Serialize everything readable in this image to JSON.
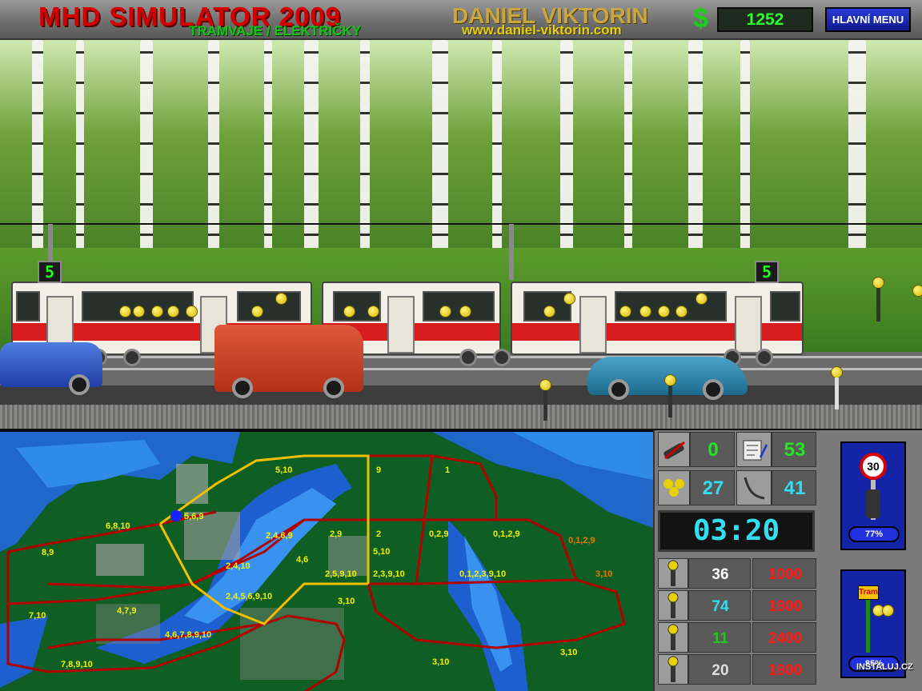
{
  "header": {
    "title": "MHD SIMULATOR 2009",
    "subtitle": "TRAMVAJE / ELEKTRIČKY",
    "author": "DANIEL VIKTORIN",
    "url": "www.daniel-viktorin.com",
    "money_symbol": "$",
    "money": "1252",
    "main_menu_label": "HLAVNÍ MENU"
  },
  "scene": {
    "tram_route_front": "5",
    "tram_route_rear": "5"
  },
  "map": {
    "labels": [
      {
        "text": "5,10"
      },
      {
        "text": "9"
      },
      {
        "text": "1"
      },
      {
        "text": "5,6,9"
      },
      {
        "text": "6,8,10"
      },
      {
        "text": "8,9"
      },
      {
        "text": "2,4,6,9"
      },
      {
        "text": "2,9"
      },
      {
        "text": "2"
      },
      {
        "text": "0,2,9"
      },
      {
        "text": "0,1,2,9"
      },
      {
        "text": "0,1,2,9"
      },
      {
        "text": "5,10"
      },
      {
        "text": "4,6"
      },
      {
        "text": "2,4,10"
      },
      {
        "text": "2,5,9,10"
      },
      {
        "text": "2,3,9,10"
      },
      {
        "text": "0,1,2,3,9,10"
      },
      {
        "text": "3,10"
      },
      {
        "text": "2,4,5,6,9,10"
      },
      {
        "text": "3,10"
      },
      {
        "text": "7,10"
      },
      {
        "text": "4,7,9"
      },
      {
        "text": "4,6,7,8,9,10"
      },
      {
        "text": "7,8,9,10"
      },
      {
        "text": "3,10"
      },
      {
        "text": "3,10"
      }
    ]
  },
  "panel": {
    "stats": [
      {
        "icon": "cancelled-tickets-icon",
        "value": "0",
        "color": "#22e622"
      },
      {
        "icon": "schedule-icon",
        "value": "53",
        "color": "#22e622"
      },
      {
        "icon": "waiting-passengers-icon",
        "value": "27",
        "color": "#34ddf0"
      },
      {
        "icon": "pantograph-icon",
        "value": "41",
        "color": "#34ddf0"
      }
    ],
    "clock": "03:20",
    "tram_types": [
      {
        "count": "36",
        "price": "1000",
        "count_color": "#ffffff"
      },
      {
        "count": "74",
        "price": "1800",
        "count_color": "#34ddf0"
      },
      {
        "count": "11",
        "price": "2400",
        "count_color": "#22c622"
      },
      {
        "count": "20",
        "price": "1800",
        "count_color": "#e0e0e0"
      }
    ],
    "price_color": "#ff1a1a",
    "speed_sign": "30",
    "speed_percent": "77%",
    "tram_stop_sign": "Tram",
    "stop_percent": "85%"
  },
  "watermark": "INSTALUJ.CZ"
}
